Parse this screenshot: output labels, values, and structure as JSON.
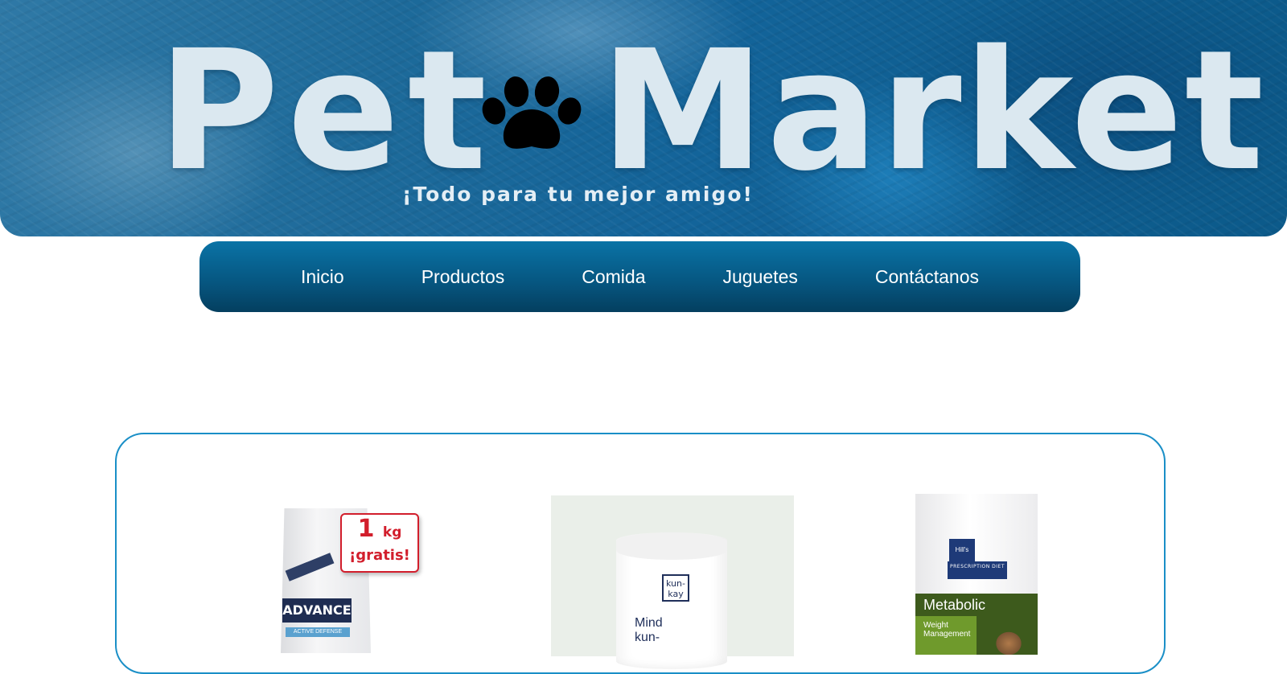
{
  "hero": {
    "title_part1": "Pet",
    "title_part2": "Market",
    "slogan": "¡Todo para tu mejor amigo!",
    "logo_icon": "paw-icon",
    "colors": {
      "title": "#dbe8f0",
      "banner_base": "#13649a",
      "paw": "#000000"
    }
  },
  "nav": {
    "items": [
      {
        "label": "Inicio"
      },
      {
        "label": "Productos"
      },
      {
        "label": "Comida"
      },
      {
        "label": "Juguetes"
      },
      {
        "label": "Contáctanos"
      }
    ],
    "colors": {
      "background": "#06557f",
      "text": "#ffffff"
    }
  },
  "products": {
    "border_color": "#1a8fc7",
    "items": [
      {
        "brand": "ADVANCE",
        "line": "ACTIVE DEFENSE",
        "promo_amount": "1",
        "promo_unit": "kg",
        "promo_text": "¡gratis!",
        "promo_color": "#d21e2c"
      },
      {
        "brand": "kun-kay",
        "name_line1": "Mind",
        "name_line2": "kun-"
      },
      {
        "brand": "Hill's",
        "line": "PRESCRIPTION DIET",
        "name": "Metabolic",
        "subtitle_line1": "Weight",
        "subtitle_line2": "Management",
        "accent_color": "#3d5a1c"
      }
    ]
  }
}
